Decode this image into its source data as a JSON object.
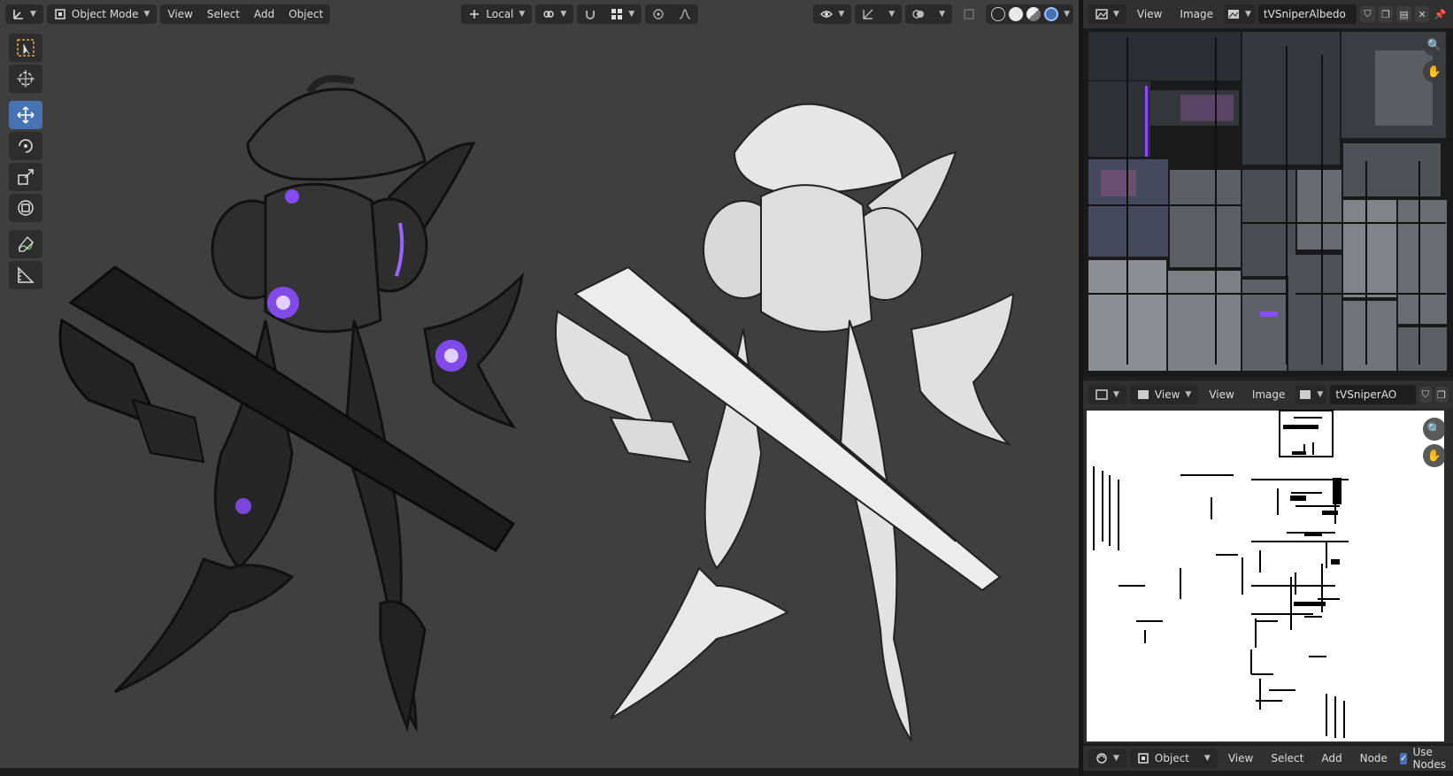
{
  "viewport": {
    "mode_label": "Object Mode",
    "menu": [
      "View",
      "Select",
      "Add",
      "Object"
    ],
    "orientation_label": "Local"
  },
  "toolbar": {
    "tools": [
      "select-box",
      "cursor",
      "move",
      "rotate",
      "scale",
      "transform",
      "annotate",
      "measure"
    ],
    "active": "move"
  },
  "image_top": {
    "menu": [
      "View",
      "Image"
    ],
    "image_name": "tVSniperAlbedo"
  },
  "image_bottom": {
    "view_dropdown": "View",
    "menu": [
      "View",
      "Image"
    ],
    "image_name": "tVSniperAO"
  },
  "node_bar": {
    "object_dropdown": "Object",
    "menu": [
      "View",
      "Select",
      "Add",
      "Node"
    ],
    "use_nodes_label": "Use Nodes",
    "use_nodes_checked": true
  },
  "colors": {
    "accent": "#4772b3",
    "viewport_bg": "#3f3f3f",
    "glow": "#8a4dff"
  }
}
